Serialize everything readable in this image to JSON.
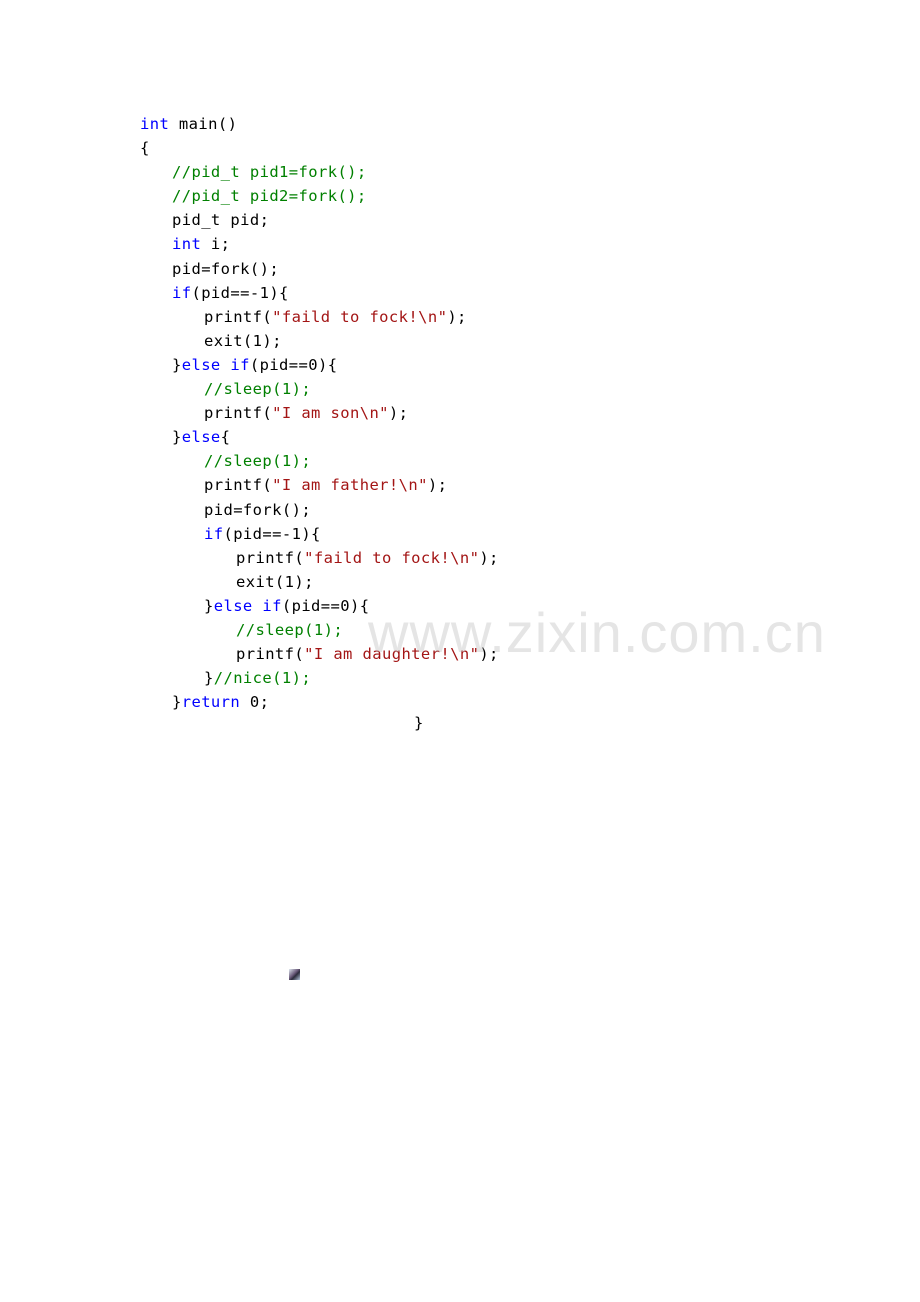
{
  "code_lines": [
    {
      "indent": 0,
      "tokens": [
        {
          "t": "int",
          "c": "kw"
        },
        {
          "t": " main()",
          "c": "pl"
        }
      ]
    },
    {
      "indent": 0,
      "tokens": [
        {
          "t": "{",
          "c": "pl"
        }
      ]
    },
    {
      "indent": 1,
      "tokens": [
        {
          "t": "//pid_t pid1=fork();",
          "c": "cm"
        }
      ]
    },
    {
      "indent": 1,
      "tokens": [
        {
          "t": "//pid_t pid2=fork();",
          "c": "cm"
        }
      ]
    },
    {
      "indent": 1,
      "tokens": [
        {
          "t": "pid_t pid;",
          "c": "pl"
        }
      ]
    },
    {
      "indent": 1,
      "tokens": [
        {
          "t": "int",
          "c": "kw"
        },
        {
          "t": " i;",
          "c": "pl"
        }
      ]
    },
    {
      "indent": 1,
      "tokens": [
        {
          "t": "pid=fork();",
          "c": "pl"
        }
      ]
    },
    {
      "indent": 1,
      "tokens": [
        {
          "t": "if",
          "c": "kw"
        },
        {
          "t": "(pid==-1){",
          "c": "pl"
        }
      ]
    },
    {
      "indent": 2,
      "tokens": [
        {
          "t": "printf(",
          "c": "pl"
        },
        {
          "t": "\"faild to fock!\\n\"",
          "c": "st"
        },
        {
          "t": ");",
          "c": "pl"
        }
      ]
    },
    {
      "indent": 2,
      "tokens": [
        {
          "t": "exit(1);",
          "c": "pl"
        }
      ]
    },
    {
      "indent": 1,
      "tokens": [
        {
          "t": "}",
          "c": "pl"
        },
        {
          "t": "else if",
          "c": "kw"
        },
        {
          "t": "(pid==0){",
          "c": "pl"
        }
      ]
    },
    {
      "indent": 2,
      "tokens": [
        {
          "t": "//sleep(1);",
          "c": "cm"
        }
      ]
    },
    {
      "indent": 2,
      "tokens": [
        {
          "t": "printf(",
          "c": "pl"
        },
        {
          "t": "\"I am son\\n\"",
          "c": "st"
        },
        {
          "t": ");",
          "c": "pl"
        }
      ]
    },
    {
      "indent": 1,
      "tokens": [
        {
          "t": "}",
          "c": "pl"
        },
        {
          "t": "else",
          "c": "kw"
        },
        {
          "t": "{",
          "c": "pl"
        }
      ]
    },
    {
      "indent": 2,
      "tokens": [
        {
          "t": "//sleep(1);",
          "c": "cm"
        }
      ]
    },
    {
      "indent": 2,
      "tokens": [
        {
          "t": "printf(",
          "c": "pl"
        },
        {
          "t": "\"I am father!\\n\"",
          "c": "st"
        },
        {
          "t": ");",
          "c": "pl"
        }
      ]
    },
    {
      "indent": 2,
      "tokens": [
        {
          "t": "pid=fork();",
          "c": "pl"
        }
      ]
    },
    {
      "indent": 2,
      "tokens": [
        {
          "t": "if",
          "c": "kw"
        },
        {
          "t": "(pid==-1){",
          "c": "pl"
        }
      ]
    },
    {
      "indent": 3,
      "tokens": [
        {
          "t": "printf(",
          "c": "pl"
        },
        {
          "t": "\"faild to fock!\\n\"",
          "c": "st"
        },
        {
          "t": ");",
          "c": "pl"
        }
      ]
    },
    {
      "indent": 3,
      "tokens": [
        {
          "t": "exit(1);",
          "c": "pl"
        }
      ]
    },
    {
      "indent": 2,
      "tokens": [
        {
          "t": "}",
          "c": "pl"
        },
        {
          "t": "else if",
          "c": "kw"
        },
        {
          "t": "(pid==0){",
          "c": "pl"
        }
      ]
    },
    {
      "indent": 3,
      "tokens": [
        {
          "t": "//sleep(1);",
          "c": "cm"
        }
      ]
    },
    {
      "indent": 3,
      "tokens": [
        {
          "t": "printf(",
          "c": "pl"
        },
        {
          "t": "\"I am daughter!\\n\"",
          "c": "st"
        },
        {
          "t": ");",
          "c": "pl"
        }
      ]
    },
    {
      "indent": 2,
      "tokens": [
        {
          "t": "}",
          "c": "pl"
        },
        {
          "t": "//nice(1);",
          "c": "cm"
        }
      ]
    },
    {
      "indent": 1,
      "tokens": [
        {
          "t": "}",
          "c": "pl"
        },
        {
          "t": "return",
          "c": "kw"
        },
        {
          "t": " 0;",
          "c": "pl"
        }
      ]
    }
  ],
  "closing_brace": "}",
  "watermark": "www.zixin.com.cn",
  "colors": {
    "keyword": "#0000ff",
    "comment": "#008000",
    "string": "#a31515",
    "plain": "#000000"
  }
}
